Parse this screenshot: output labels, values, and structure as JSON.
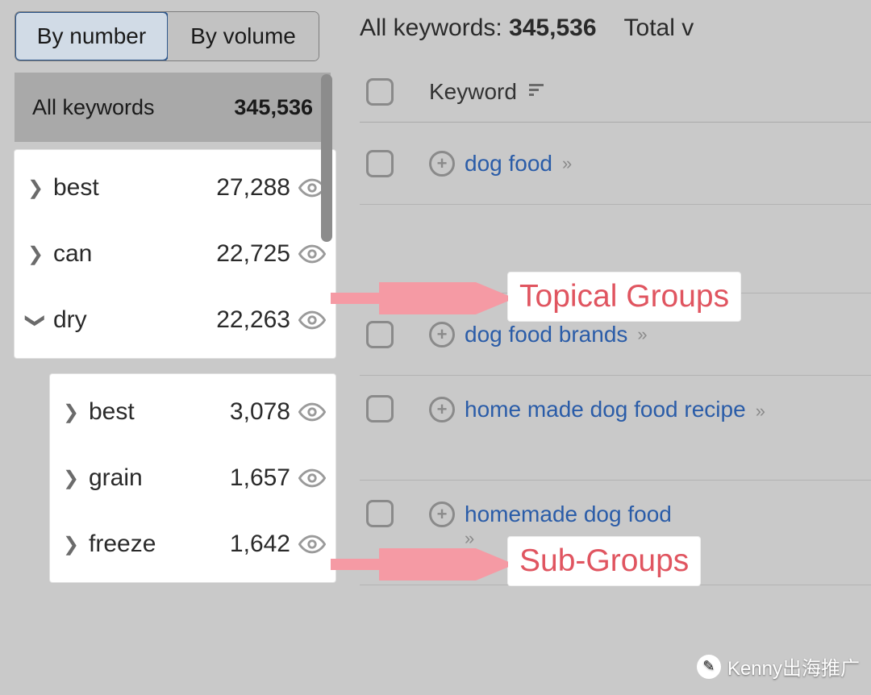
{
  "sidebar": {
    "tabs": {
      "by_number": "By number",
      "by_volume": "By volume",
      "active": "by_number"
    },
    "summary": {
      "label": "All keywords",
      "count": "345,536"
    },
    "groups": [
      {
        "name": "best",
        "count": "27,288",
        "expanded": false
      },
      {
        "name": "can",
        "count": "22,725",
        "expanded": false
      },
      {
        "name": "dry",
        "count": "22,263",
        "expanded": true
      }
    ],
    "subgroups": [
      {
        "name": "best",
        "count": "3,078"
      },
      {
        "name": "grain",
        "count": "1,657"
      },
      {
        "name": "freeze",
        "count": "1,642"
      }
    ]
  },
  "main": {
    "stats": {
      "all_label": "All keywords:",
      "all_value": "345,536",
      "total_label": "Total v"
    },
    "column_header": "Keyword",
    "rows": [
      {
        "keyword": "dog food"
      },
      {
        "keyword": "dog food brands"
      },
      {
        "keyword": "home made dog food recipe"
      },
      {
        "keyword": "homemade dog food"
      }
    ]
  },
  "annotations": {
    "topical": "Topical Groups",
    "sub": "Sub-Groups"
  },
  "watermark": "Kenny出海推广"
}
